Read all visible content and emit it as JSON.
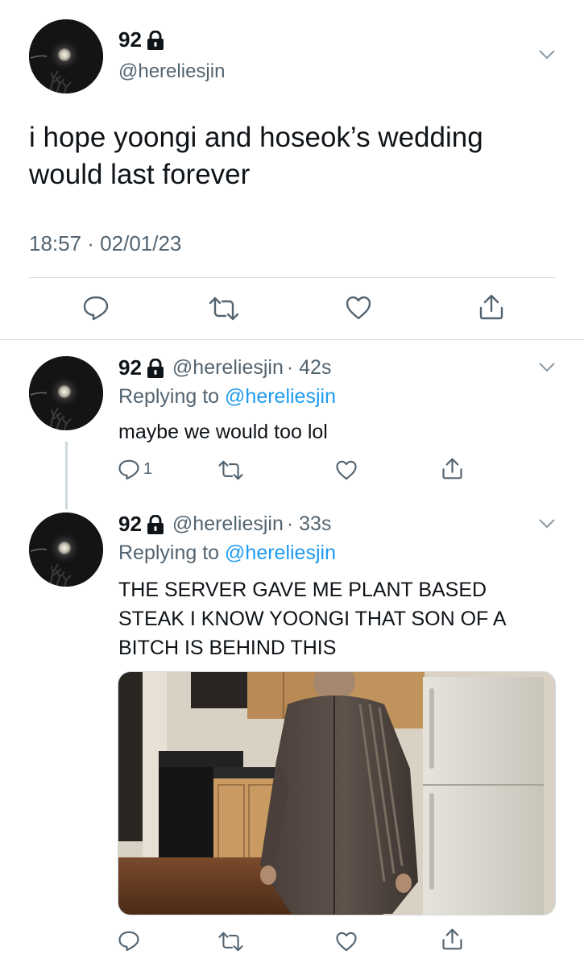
{
  "main_tweet": {
    "display_name": "92",
    "handle": "@hereliesjin",
    "text": "i hope yoongi and hoseok’s wedding would last forever",
    "timestamp": "18:57 · 02/01/23"
  },
  "replies": [
    {
      "display_name": "92",
      "handle": "@hereliesjin",
      "time": "· 42s",
      "replying_label": "Replying to",
      "replying_handle": "@hereliesjin",
      "text": "maybe we would too lol",
      "reply_count": "1"
    },
    {
      "display_name": "92",
      "handle": "@hereliesjin",
      "time": "· 33s",
      "replying_label": "Replying to",
      "replying_handle": "@hereliesjin",
      "text": "THE SERVER GAVE ME PLANT BASED STEAK I KNOW YOONGI THAT SON OF A BITCH IS BEHIND THIS",
      "media": "photo of a man in a brown zip jacket standing in a kitchen beside a white refrigerator"
    }
  ],
  "icons": [
    "lock-icon",
    "chevron-down-icon",
    "reply-icon",
    "retweet-icon",
    "like-icon",
    "share-icon"
  ],
  "colors": {
    "accent": "#1d9bf0",
    "text": "#0f1419",
    "secondary": "#536471",
    "divider": "#d8dde1"
  }
}
